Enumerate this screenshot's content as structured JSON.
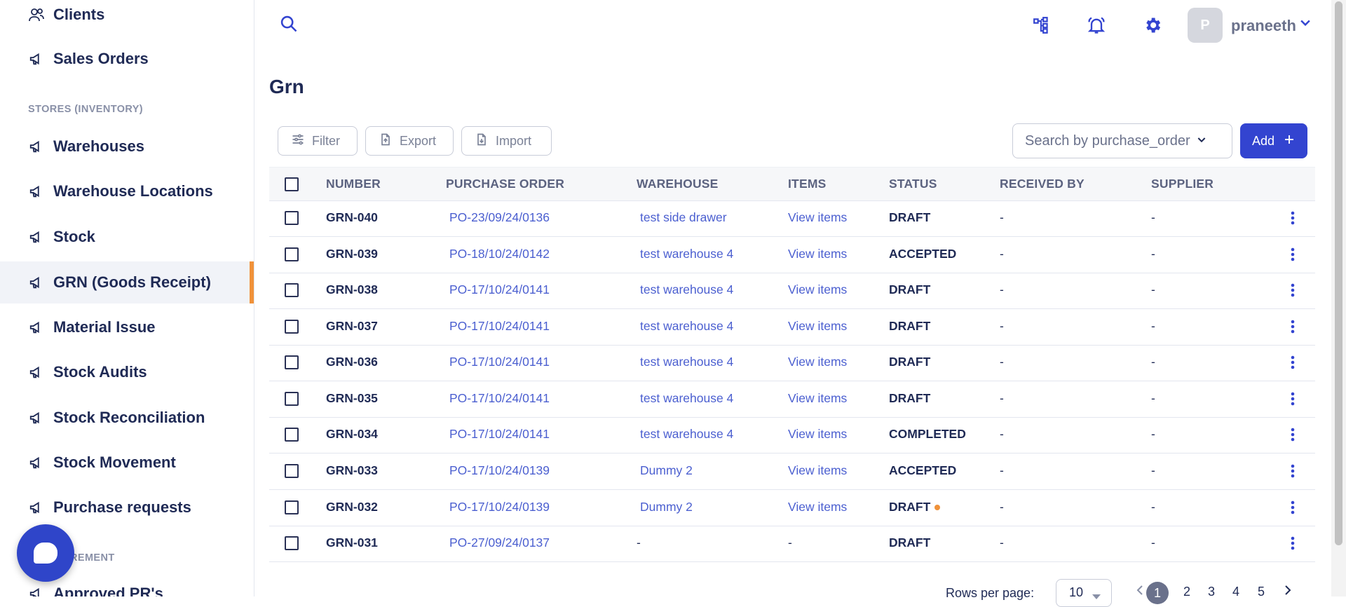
{
  "sidebar": {
    "items_top": [
      {
        "label": "Clients",
        "icon": "users-icon"
      },
      {
        "label": "Sales Orders",
        "icon": "megaphone-icon"
      }
    ],
    "section_stores": "STORES (INVENTORY)",
    "items": [
      {
        "label": "Warehouses"
      },
      {
        "label": "Warehouse Locations"
      },
      {
        "label": "Stock"
      },
      {
        "label": "GRN (Goods Receipt)"
      },
      {
        "label": "Material Issue"
      },
      {
        "label": "Stock Audits"
      },
      {
        "label": "Stock Reconciliation"
      },
      {
        "label": "Stock Movement"
      },
      {
        "label": "Purchase requests"
      }
    ],
    "section_procurement": "REMENT",
    "item_partial": "Approved PR's",
    "active": "GRN (Goods Receipt)"
  },
  "header": {
    "avatar_initial": "P",
    "username": "praneeth"
  },
  "page": {
    "title": "Grn"
  },
  "toolbar": {
    "filter_label": "Filter",
    "export_label": "Export",
    "import_label": "Import",
    "search_select": "Search by purchase_order",
    "add_label": "Add"
  },
  "table": {
    "columns": [
      "NUMBER",
      "PURCHASE ORDER",
      "WAREHOUSE",
      "ITEMS",
      "STATUS",
      "RECEIVED BY",
      "SUPPLIER"
    ],
    "rows": [
      {
        "number": "GRN-040",
        "po": "PO-23/09/24/0136",
        "warehouse": "test side drawer",
        "items": "View items",
        "status": "DRAFT",
        "received_by": "-",
        "supplier": "-"
      },
      {
        "number": "GRN-039",
        "po": "PO-18/10/24/0142",
        "warehouse": "test warehouse 4",
        "items": "View items",
        "status": "ACCEPTED",
        "received_by": "-",
        "supplier": "-"
      },
      {
        "number": "GRN-038",
        "po": "PO-17/10/24/0141",
        "warehouse": "test warehouse 4",
        "items": "View items",
        "status": "DRAFT",
        "received_by": "-",
        "supplier": "-"
      },
      {
        "number": "GRN-037",
        "po": "PO-17/10/24/0141",
        "warehouse": "test warehouse 4",
        "items": "View items",
        "status": "DRAFT",
        "received_by": "-",
        "supplier": "-"
      },
      {
        "number": "GRN-036",
        "po": "PO-17/10/24/0141",
        "warehouse": "test warehouse 4",
        "items": "View items",
        "status": "DRAFT",
        "received_by": "-",
        "supplier": "-"
      },
      {
        "number": "GRN-035",
        "po": "PO-17/10/24/0141",
        "warehouse": "test warehouse 4",
        "items": "View items",
        "status": "DRAFT",
        "received_by": "-",
        "supplier": "-"
      },
      {
        "number": "GRN-034",
        "po": "PO-17/10/24/0141",
        "warehouse": "test warehouse 4",
        "items": "View items",
        "status": "COMPLETED",
        "received_by": "-",
        "supplier": "-"
      },
      {
        "number": "GRN-033",
        "po": "PO-17/10/24/0139",
        "warehouse": "Dummy 2",
        "items": "View items",
        "status": "ACCEPTED",
        "received_by": "-",
        "supplier": "-"
      },
      {
        "number": "GRN-032",
        "po": "PO-17/10/24/0139",
        "warehouse": "Dummy 2",
        "items": "View items",
        "status": "DRAFT",
        "received_by": "-",
        "supplier": "-"
      },
      {
        "number": "GRN-031",
        "po": "PO-27/09/24/0137",
        "warehouse": "-",
        "items": "-",
        "status": "DRAFT",
        "received_by": "-",
        "supplier": "-"
      }
    ]
  },
  "pagination": {
    "rows_per_page_label": "Rows per page:",
    "rows_per_page": "10",
    "pages": [
      "1",
      "2",
      "3",
      "4",
      "5"
    ],
    "current": "1"
  },
  "colors": {
    "accent": "#3344d0",
    "active_bar": "#f0923a",
    "link": "#4b5fd0"
  }
}
